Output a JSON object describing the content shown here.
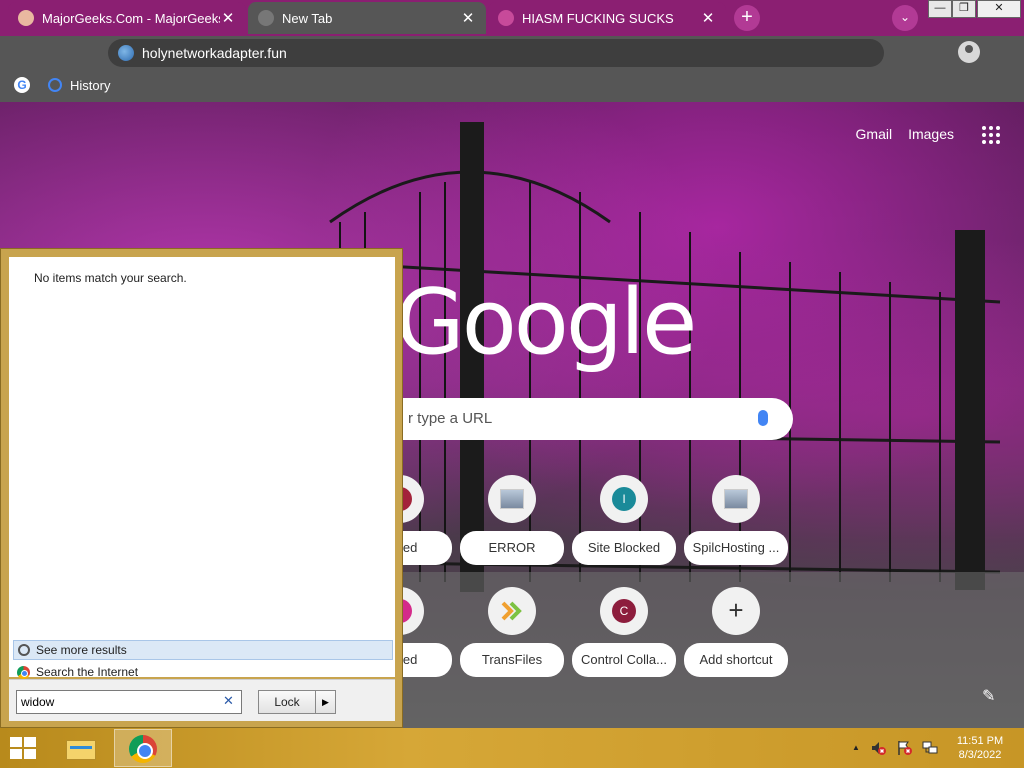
{
  "browser": {
    "tabs": [
      {
        "title": "MajorGeeks.Com - MajorGeeks"
      },
      {
        "title": "New Tab"
      },
      {
        "title": "HIASM FUCKING SUCKS"
      }
    ],
    "new_tab_symbol": "+",
    "tab_search_symbol": "⌄",
    "close_symbol": "✕",
    "url": "holynetworkadapter.fun",
    "bookmarks": [
      {
        "label": "History"
      }
    ],
    "window_controls": {
      "minimize": "—",
      "maximize": "❐",
      "close": "✕"
    }
  },
  "ntp": {
    "links": {
      "gmail": "Gmail",
      "images": "Images"
    },
    "logo": "Google",
    "search_placeholder": "r type a URL",
    "shortcuts": [
      {
        "label": "ocked",
        "initial": "",
        "color": "#a3233a"
      },
      {
        "label": "ERROR",
        "initial": "",
        "color": ""
      },
      {
        "label": "Site Blocked",
        "initial": "I",
        "color": "#1a8a99"
      },
      {
        "label": "SpilcHosting ...",
        "initial": "",
        "color": ""
      },
      {
        "label": "ocked",
        "initial": "",
        "color": "#d42b8a"
      },
      {
        "label": "TransFiles",
        "initial": "",
        "color": ""
      },
      {
        "label": "Control Colla...",
        "initial": "C",
        "color": "#8d1d3d"
      },
      {
        "label": "Add shortcut",
        "initial": "+",
        "color": ""
      }
    ],
    "edit_symbol": "✎"
  },
  "start_search": {
    "no_items": "No items match your search.",
    "see_more": "See more results",
    "search_internet": "Search the Internet",
    "query": "widow",
    "clear_symbol": "✕",
    "lock_label": "Lock",
    "arrow_symbol": "▶"
  },
  "taskbar": {
    "time": "11:51 PM",
    "date": "8/3/2022",
    "tray_up_symbol": "▲"
  }
}
